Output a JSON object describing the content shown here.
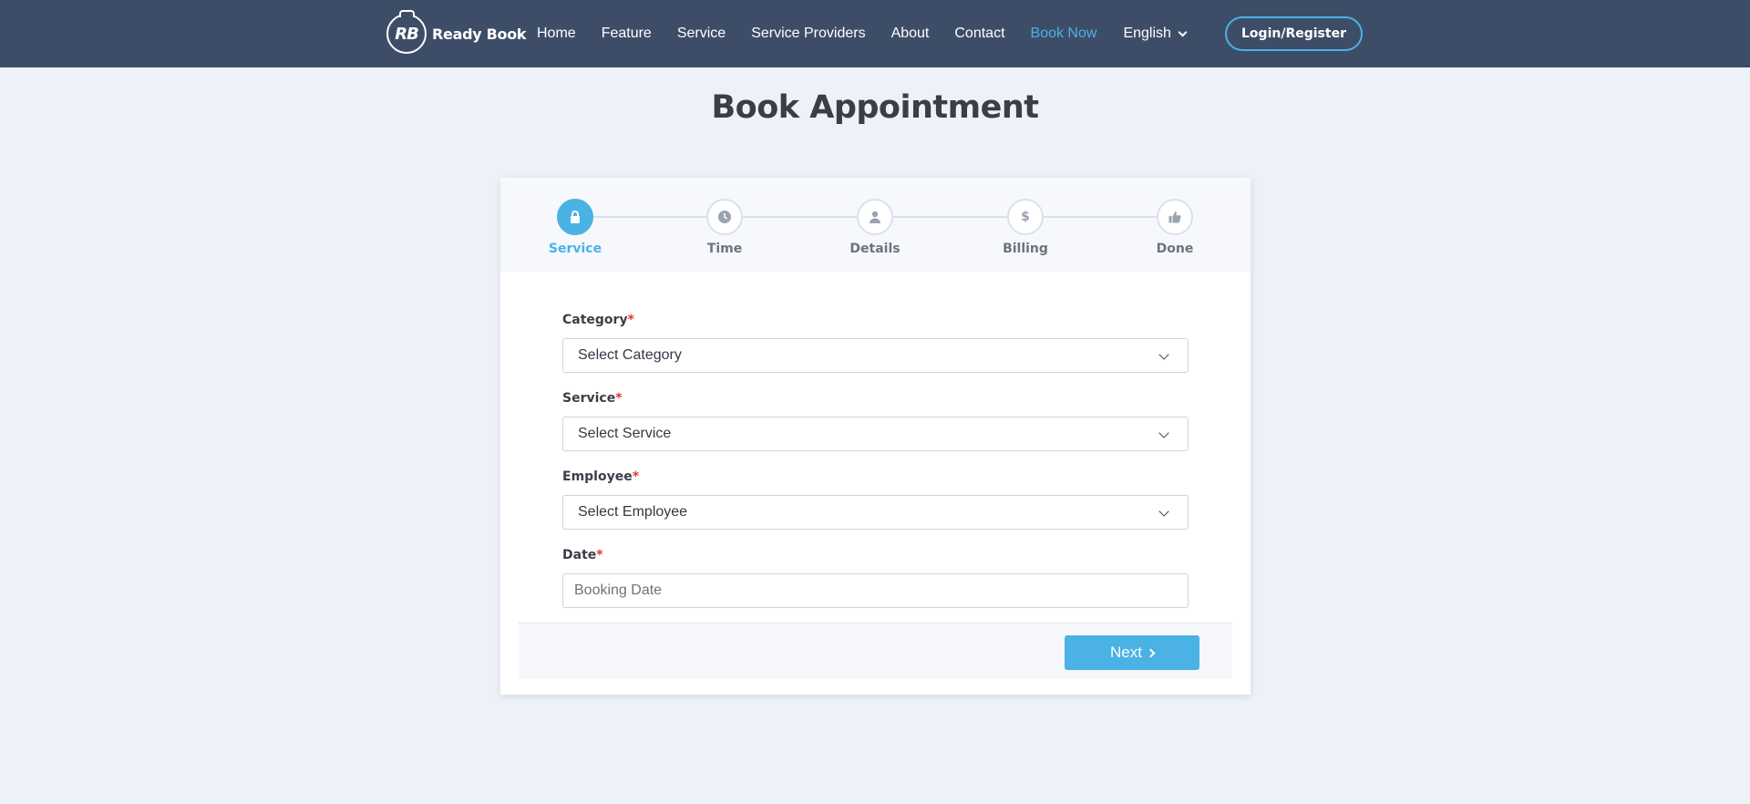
{
  "brand": {
    "monogram": "RB",
    "name": "Ready Book"
  },
  "nav": {
    "links": [
      "Home",
      "Feature",
      "Service",
      "Service Providers",
      "About",
      "Contact",
      "Book Now"
    ],
    "active": "Book Now",
    "language": "English",
    "login_label": "Login/Register"
  },
  "page": {
    "title": "Book Appointment"
  },
  "steps": [
    {
      "label": "Service",
      "icon": "lock-icon",
      "active": true
    },
    {
      "label": "Time",
      "icon": "clock-icon",
      "active": false
    },
    {
      "label": "Details",
      "icon": "user-icon",
      "active": false
    },
    {
      "label": "Billing",
      "icon": "dollar-icon",
      "symbol": "$",
      "active": false
    },
    {
      "label": "Done",
      "icon": "thumbs-up-icon",
      "active": false
    }
  ],
  "form": {
    "category": {
      "label": "Category",
      "value": "Select Category"
    },
    "service": {
      "label": "Service",
      "value": "Select Service"
    },
    "employee": {
      "label": "Employee",
      "value": "Select Employee"
    },
    "date": {
      "label": "Date",
      "placeholder": "Booking Date"
    },
    "required_mark": "*",
    "next_label": "Next"
  },
  "colors": {
    "nav_bg": "#3e4d67",
    "accent": "#4ab2e5",
    "page_bg": "#edf1f8",
    "required": "#e0363c"
  }
}
